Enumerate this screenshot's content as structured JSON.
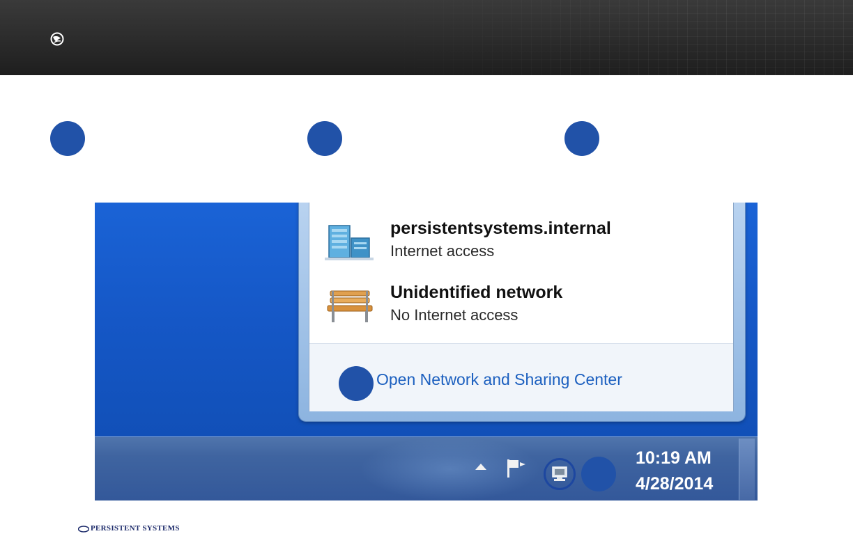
{
  "header": {
    "logo_icon": "persistent-systems-mark-icon"
  },
  "steps": [
    {
      "marker": ""
    },
    {
      "marker": ""
    },
    {
      "marker": ""
    }
  ],
  "network_popup": {
    "networks": [
      {
        "name": "persistentsystems.internal",
        "status": "Internet access",
        "icon": "domain-network-icon"
      },
      {
        "name": "Unidentified network",
        "status": "No Internet access",
        "icon": "public-bench-network-icon"
      }
    ],
    "footer_link": "Open Network and Sharing Center"
  },
  "taskbar": {
    "time": "10:19 AM",
    "date": "4/28/2014",
    "icons": [
      "show-hidden-icons-arrow-icon",
      "action-center-flag-icon",
      "network-icon"
    ]
  },
  "branding": {
    "company": "PERSISTENT SYSTEMS"
  },
  "colors": {
    "step_marker": "#2152a8",
    "desktop": "#1557c6",
    "link": "#1b5fbf"
  }
}
